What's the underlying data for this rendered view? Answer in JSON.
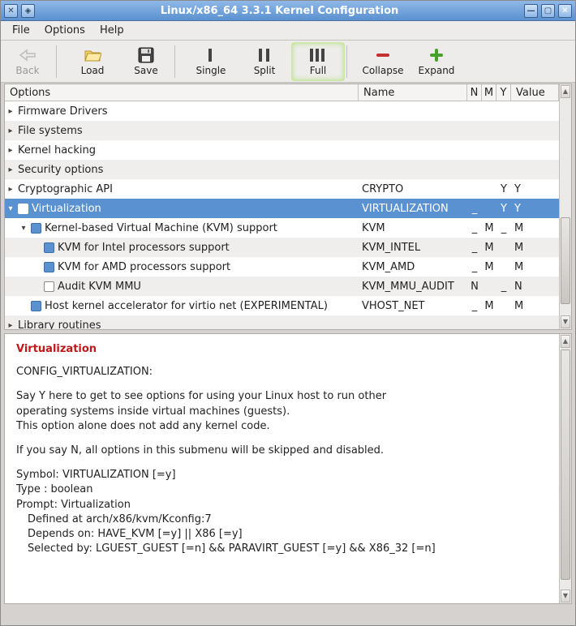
{
  "titlebar": {
    "title": "Linux/x86_64 3.3.1 Kernel Configuration"
  },
  "menus": {
    "file": "File",
    "options": "Options",
    "help": "Help"
  },
  "toolbar": {
    "back": "Back",
    "load": "Load",
    "save": "Save",
    "single": "Single",
    "split": "Split",
    "full": "Full",
    "collapse": "Collapse",
    "expand": "Expand"
  },
  "columns": {
    "options": "Options",
    "name": "Name",
    "n": "N",
    "m": "M",
    "y": "Y",
    "value": "Value"
  },
  "rows": [
    {
      "indent": 0,
      "arrow": "▸",
      "chk": null,
      "label": "Firmware Drivers",
      "name": "",
      "n": "",
      "m": "",
      "y": "",
      "val": ""
    },
    {
      "indent": 0,
      "arrow": "▸",
      "chk": null,
      "label": "File systems",
      "name": "",
      "n": "",
      "m": "",
      "y": "",
      "val": ""
    },
    {
      "indent": 0,
      "arrow": "▸",
      "chk": null,
      "label": "Kernel hacking",
      "name": "",
      "n": "",
      "m": "",
      "y": "",
      "val": ""
    },
    {
      "indent": 0,
      "arrow": "▸",
      "chk": null,
      "label": "Security options",
      "name": "",
      "n": "",
      "m": "",
      "y": "",
      "val": ""
    },
    {
      "indent": 0,
      "arrow": "▸",
      "chk": null,
      "label": "Cryptographic API",
      "name": "CRYPTO",
      "n": "",
      "m": "",
      "y": "Y",
      "val": "Y"
    },
    {
      "indent": 0,
      "arrow": "▾",
      "chk": "checked",
      "selected": true,
      "label": "Virtualization",
      "name": "VIRTUALIZATION",
      "n": "_",
      "m": "",
      "y": "Y",
      "val": "Y"
    },
    {
      "indent": 1,
      "arrow": "▾",
      "chk": "filled",
      "label": "Kernel-based Virtual Machine (KVM) support",
      "name": "KVM",
      "n": "_",
      "m": "M",
      "y": "_",
      "val": "M"
    },
    {
      "indent": 2,
      "arrow": "",
      "chk": "filled",
      "label": "KVM for Intel processors support",
      "name": "KVM_INTEL",
      "n": "_",
      "m": "M",
      "y": "",
      "val": "M"
    },
    {
      "indent": 2,
      "arrow": "",
      "chk": "filled",
      "label": "KVM for AMD processors support",
      "name": "KVM_AMD",
      "n": "_",
      "m": "M",
      "y": "",
      "val": "M"
    },
    {
      "indent": 2,
      "arrow": "",
      "chk": "empty",
      "label": "Audit KVM MMU",
      "name": "KVM_MMU_AUDIT",
      "n": "N",
      "m": "",
      "y": "_",
      "val": "N"
    },
    {
      "indent": 1,
      "arrow": "",
      "chk": "filled",
      "label": "Host kernel accelerator for virtio net (EXPERIMENTAL)",
      "name": "VHOST_NET",
      "n": "_",
      "m": "M",
      "y": "",
      "val": "M"
    },
    {
      "indent": 0,
      "arrow": "▸",
      "chk": null,
      "label": "Library routines",
      "name": "",
      "n": "",
      "m": "",
      "y": "",
      "val": ""
    }
  ],
  "help": {
    "title": "Virtualization",
    "config_line": "CONFIG_VIRTUALIZATION:",
    "p1a": "Say Y here to get to see options for using your Linux host to run other",
    "p1b": "operating systems inside virtual machines (guests).",
    "p1c": "This option alone does not add any kernel code.",
    "p2": "If you say N, all options in this submenu will be skipped and disabled.",
    "sym": "Symbol: VIRTUALIZATION [=y]",
    "type": "Type  : boolean",
    "prompt": "Prompt: Virtualization",
    "defined": "Defined at arch/x86/kvm/Kconfig:7",
    "depends": "Depends on: HAVE_KVM [=y] || X86 [=y]",
    "selected": "Selected by: LGUEST_GUEST [=n] && PARAVIRT_GUEST [=y] && X86_32 [=n]"
  }
}
